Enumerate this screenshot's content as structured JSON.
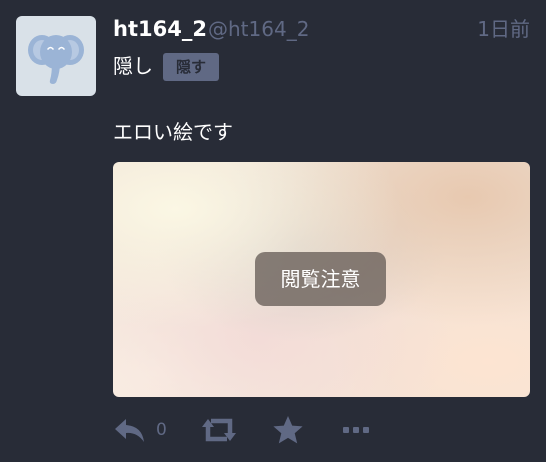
{
  "account": {
    "display_name": "ht164_2",
    "acct": "@ht164_2",
    "avatar_icon": "elephant-avatar-icon"
  },
  "status": {
    "relative_time": "1日前",
    "spoiler_text": "隠し",
    "spoiler_toggle_label": "隠す",
    "content": "エロい絵です",
    "media_sensitive_label": "閲覧注意",
    "reply_count": "0"
  },
  "icons": {
    "reply": "reply-icon",
    "boost": "boost-icon",
    "favourite": "star-icon",
    "more": "more-icon"
  },
  "colors": {
    "background": "#282c37",
    "muted_text": "#606984",
    "primary_text": "#ffffff",
    "spoiler_button_bg": "#606984",
    "avatar_bg": "#d9e1e8",
    "elephant": "#9bb4d6"
  }
}
